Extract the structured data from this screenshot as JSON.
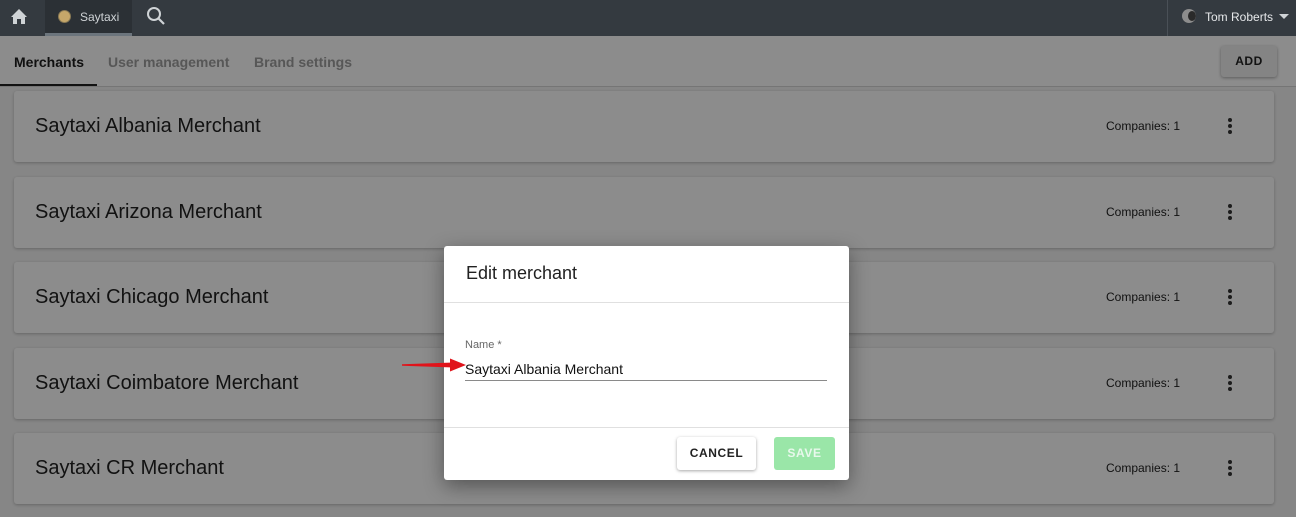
{
  "topbar": {
    "home_icon": "home-icon",
    "tab_label": "Saytaxi",
    "search_icon": "search-icon",
    "user_name": "Tom Roberts",
    "dropdown_icon": "caret-down-icon"
  },
  "subnav": {
    "tabs": [
      {
        "label": "Merchants",
        "active": true
      },
      {
        "label": "User management",
        "active": false
      },
      {
        "label": "Brand settings",
        "active": false
      }
    ],
    "add_label": "ADD"
  },
  "merchants": [
    {
      "name": "Saytaxi Albania Merchant",
      "companies": "Companies: 1"
    },
    {
      "name": "Saytaxi Arizona Merchant",
      "companies": "Companies: 1"
    },
    {
      "name": "Saytaxi Chicago Merchant",
      "companies": "Companies: 1"
    },
    {
      "name": "Saytaxi Coimbatore Merchant",
      "companies": "Companies: 1"
    },
    {
      "name": "Saytaxi CR Merchant",
      "companies": "Companies: 1"
    }
  ],
  "modal": {
    "title": "Edit merchant",
    "field_label": "Name *",
    "field_value": "Saytaxi Albania Merchant",
    "cancel_label": "CANCEL",
    "save_label": "SAVE"
  },
  "colors": {
    "topbar": "#343a40",
    "save_disabled": "#9ae6a8",
    "annotation_arrow": "#e0141b"
  }
}
